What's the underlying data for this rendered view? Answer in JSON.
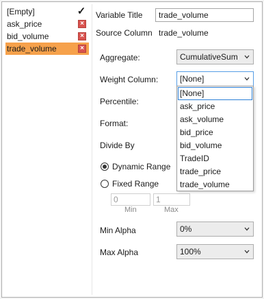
{
  "variables": [
    {
      "label": "[Empty]",
      "checked": true
    },
    {
      "label": "ask_price"
    },
    {
      "label": "bid_volume"
    },
    {
      "label": "trade_volume",
      "selected": true
    }
  ],
  "form": {
    "variable_title_label": "Variable Title",
    "variable_title_value": "trade_volume",
    "source_column_label": "Source Column",
    "source_column_value": "trade_volume",
    "aggregate_label": "Aggregate:",
    "aggregate_value": "CumulativeSum",
    "weight_label": "Weight Column:",
    "weight_value": "[None]",
    "percentile_label": "Percentile:",
    "format_label": "Format:",
    "divide_by_label": "Divide By",
    "dynamic_range_label": "Dynamic Range",
    "fixed_range_label": "Fixed Range",
    "min_value": "0",
    "max_value": "1",
    "min_label": "Min",
    "max_label": "Max",
    "min_alpha_label": "Min Alpha",
    "min_alpha_value": "0%",
    "max_alpha_label": "Max Alpha",
    "max_alpha_value": "100%"
  },
  "weight_options": [
    "[None]",
    "ask_price",
    "ask_volume",
    "bid_price",
    "bid_volume",
    "TradeID",
    "trade_price",
    "trade_volume"
  ],
  "colors": {
    "selection": "#f6a14b",
    "remove": "#d9534f",
    "focus": "#569de5"
  }
}
